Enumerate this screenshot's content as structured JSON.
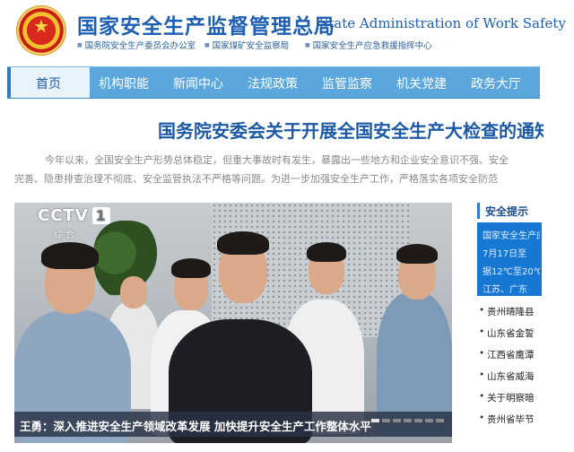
{
  "header": {
    "title_cn": "国家安全生产监督管理总局",
    "title_en": "State Administration of Work Safety",
    "sublinks": [
      "国务院安全生产委员会办公室",
      "国家煤矿安全监察局",
      "国家安全生产应急救援指挥中心"
    ]
  },
  "nav": {
    "items": [
      "首页",
      "机构职能",
      "新闻中心",
      "法规政策",
      "监管监察",
      "机关党建",
      "政务大厅"
    ]
  },
  "article": {
    "headline": "国务院安委会关于开展全国安全生产大检查的通知",
    "lede_line1": "今年以来，全国安全生产形势总体稳定，但重大事故时有发生，暴露出一些地方和企业安全意识不强、安全",
    "lede_line2": "完善、隐患排查治理不彻底、安全监管执法不严格等问题。为进一步加强安全生产工作，严格落实各项安全防范"
  },
  "video": {
    "channel_logo": "CCTV",
    "channel_number": "1",
    "channel_sub": "综 合",
    "caption": "王勇：深入推进安全生产领域改革发展 加快提升安全生产工作整体水平",
    "slides": 7,
    "active_slide": 1
  },
  "sidebar": {
    "title": "安全提示",
    "box_lines": [
      "国家安全生产应急",
      "7月17日至",
      "据12℃至20℃",
      "江苏、广东"
    ],
    "list": [
      "贵州晴隆县",
      "山东省金誓",
      "江西省鹰潭",
      "山东省威海",
      "关于明察暗",
      "贵州省毕节"
    ]
  },
  "colors": {
    "brand_blue": "#1f5fb1",
    "nav_blue": "#5aa6dd",
    "alert_box": "#1778d4"
  }
}
